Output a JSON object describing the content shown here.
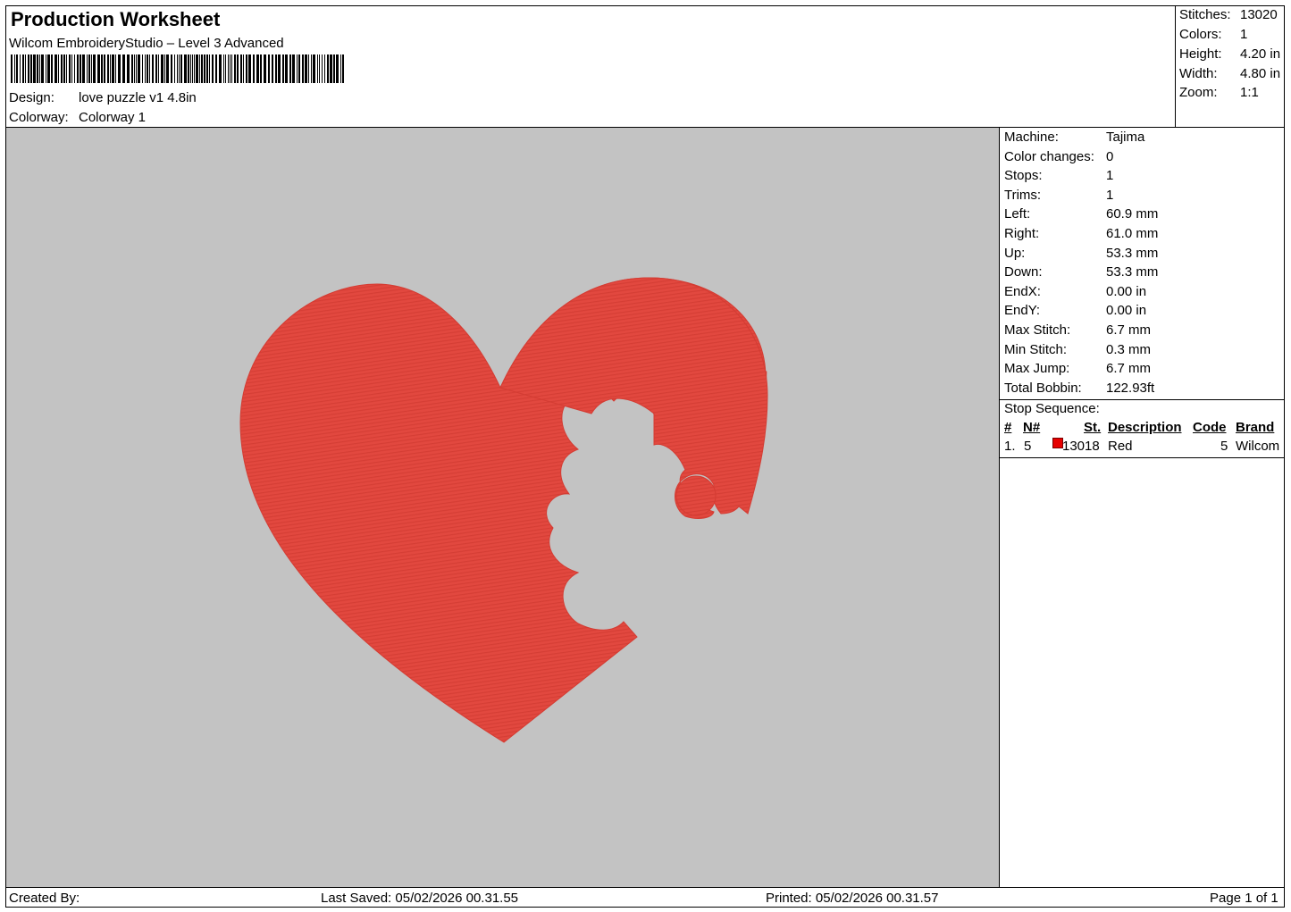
{
  "header": {
    "title": "Production Worksheet",
    "software": "Wilcom EmbroideryStudio – Level 3 Advanced",
    "design_label": "Design:",
    "design_value": "love puzzle v1 4.8in",
    "colorway_label": "Colorway:",
    "colorway_value": "Colorway 1"
  },
  "summary": {
    "stitches_label": "Stitches:",
    "stitches": "13020",
    "colors_label": "Colors:",
    "colors": "1",
    "height_label": "Height:",
    "height": "4.20 in",
    "width_label": "Width:",
    "width": "4.80 in",
    "zoom_label": "Zoom:",
    "zoom": "1:1"
  },
  "machine_stats": [
    {
      "label": "Machine:",
      "value": "Tajima"
    },
    {
      "label": "Color changes:",
      "value": "0"
    },
    {
      "label": "Stops:",
      "value": "1"
    },
    {
      "label": "Trims:",
      "value": "1"
    },
    {
      "label": "Left:",
      "value": "60.9 mm"
    },
    {
      "label": "Right:",
      "value": "61.0 mm"
    },
    {
      "label": "Up:",
      "value": "53.3 mm"
    },
    {
      "label": "Down:",
      "value": "53.3 mm"
    },
    {
      "label": "EndX:",
      "value": "0.00 in"
    },
    {
      "label": "EndY:",
      "value": "0.00 in"
    },
    {
      "label": "Max Stitch:",
      "value": "6.7 mm"
    },
    {
      "label": "Min Stitch:",
      "value": "0.3 mm"
    },
    {
      "label": "Max Jump:",
      "value": "6.7 mm"
    },
    {
      "label": "Total Bobbin:",
      "value": "122.93ft"
    }
  ],
  "stop_sequence": {
    "title": "Stop Sequence:",
    "headers": {
      "num": "#",
      "needle": "N#",
      "st": "St.",
      "description": "Description",
      "code": "Code",
      "brand": "Brand"
    },
    "rows": [
      {
        "num": "1.",
        "needle": "5",
        "color": "#e60000",
        "st": "13018",
        "description": "Red",
        "code": "5",
        "brand": "Wilcom"
      }
    ]
  },
  "design_preview": {
    "background": "#c3c3c3",
    "thread_color": "#e2483f",
    "shape": "heart with puzzle-piece cutout"
  },
  "footer": {
    "created_by": "Created By:",
    "last_saved": "Last Saved: 05/02/2026 00.31.55",
    "printed": "Printed: 05/02/2026 00.31.57",
    "page": "Page 1 of 1"
  }
}
